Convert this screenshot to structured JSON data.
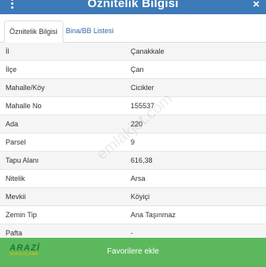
{
  "window": {
    "title": "Öznitelik Bilgisi",
    "close_label": "×"
  },
  "tabs": [
    {
      "label": "Öznitelik Bilgisi",
      "active": true
    },
    {
      "label": "Bina/BB Listesi",
      "active": false
    }
  ],
  "rows": [
    {
      "key": "İl",
      "value": "Çanakkale"
    },
    {
      "key": "İlçe",
      "value": "Çan"
    },
    {
      "key": "Mahalle/Köy",
      "value": "Cicikler"
    },
    {
      "key": "Mahalle No",
      "value": "155537"
    },
    {
      "key": "Ada",
      "value": "220"
    },
    {
      "key": "Parsel",
      "value": "9"
    },
    {
      "key": "Tapu Alanı",
      "value": "616,38"
    },
    {
      "key": "Nitelik",
      "value": "Arsa"
    },
    {
      "key": "Mevkii",
      "value": "Köyiçi"
    },
    {
      "key": "Zemin Tip",
      "value": "Ana Taşınmaz"
    },
    {
      "key": "Pafta",
      "value": "-"
    }
  ],
  "footer": {
    "button_label": "Favorilere ekle"
  },
  "logo": {
    "line1": "ARAZİ",
    "line2": "SORGULAMA"
  },
  "watermark": "emlakjet.com",
  "colors": {
    "titlebar": "#3c7ab8",
    "footer": "#5cb85c",
    "link": "#2a6aa8"
  }
}
